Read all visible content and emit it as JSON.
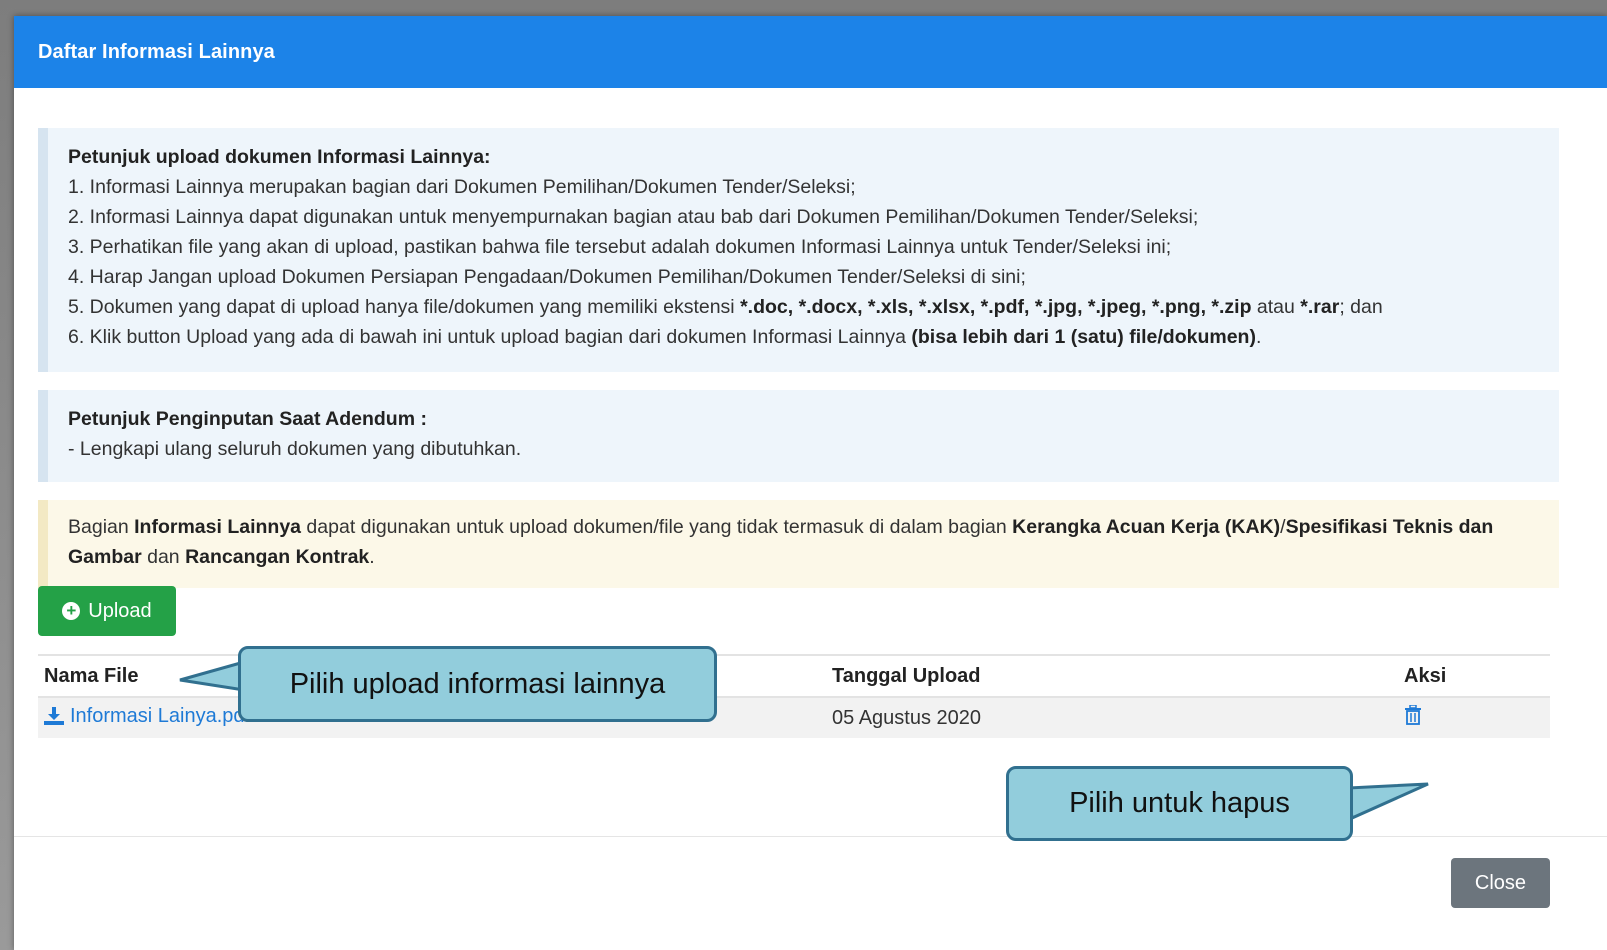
{
  "modal": {
    "title": "Daftar Informasi Lainnya"
  },
  "instructions": {
    "heading": "Petunjuk upload dokumen Informasi Lainnya:",
    "item1": "1. Informasi Lainnya merupakan bagian dari Dokumen Pemilihan/Dokumen Tender/Seleksi;",
    "item2": "2. Informasi Lainnya dapat digunakan untuk menyempurnakan bagian atau bab dari Dokumen Pemilihan/Dokumen Tender/Seleksi;",
    "item3": "3. Perhatikan file yang akan di upload, pastikan bahwa file tersebut adalah dokumen Informasi Lainnya untuk Tender/Seleksi ini;",
    "item4": "4. Harap Jangan upload Dokumen Persiapan Pengadaan/Dokumen Pemilihan/Dokumen Tender/Seleksi di sini;",
    "item5_pre": "5. Dokumen yang dapat di upload hanya file/dokumen yang memiliki ekstensi ",
    "item5_ext": "*.doc, *.docx, *.xls, *.xlsx, *.pdf, *.jpg, *.jpeg, *.png, *.zip",
    "item5_mid": " atau ",
    "item5_rar": "*.rar",
    "item5_post": "; dan",
    "item6_pre": "6. Klik button Upload yang ada di bawah ini untuk upload bagian dari dokumen Informasi Lainnya ",
    "item6_bold": "(bisa lebih dari 1 (satu) file/dokumen)",
    "item6_post": "."
  },
  "addendum": {
    "heading": "Petunjuk Penginputan Saat Adendum :",
    "text": "- Lengkapi ulang seluruh dokumen yang dibutuhkan."
  },
  "warning": {
    "t1": "Bagian ",
    "b1": "Informasi Lainnya",
    "t2": " dapat digunakan untuk upload dokumen/file yang tidak termasuk di dalam bagian ",
    "b2": "Kerangka Acuan Kerja (KAK)",
    "t3": "/",
    "b3": "Spesifikasi Teknis dan Gambar",
    "t4": " dan ",
    "b4": "Rancangan Kontrak",
    "t5": "."
  },
  "upload_button": {
    "label": "Upload",
    "icon": "plus-circle-icon"
  },
  "table": {
    "headers": {
      "name": "Nama File",
      "date": "Tanggal Upload",
      "action": "Aksi"
    },
    "rows": [
      {
        "file": "Informasi Lainya.pdf - 174 KB",
        "date": "05 Agustus 2020",
        "action_icon": "trash-icon"
      }
    ]
  },
  "close_button": {
    "label": "Close"
  },
  "callouts": {
    "upload": "Pilih upload informasi lainnya",
    "delete": "Pilih untuk hapus"
  },
  "colors": {
    "header_blue": "#1c83e8",
    "upload_green": "#24a147",
    "callout_fill": "#92cddc",
    "callout_border": "#31708f",
    "link_blue": "#1e7ad6",
    "close_grey": "#6c757d"
  }
}
